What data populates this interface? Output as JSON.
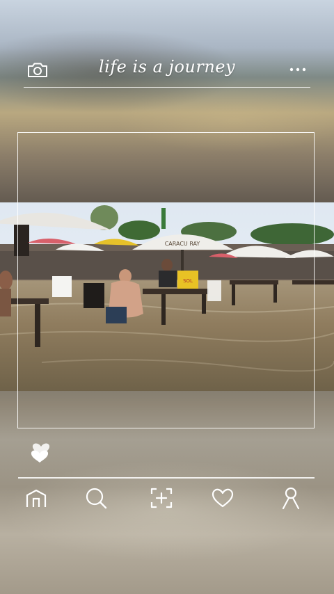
{
  "header": {
    "title": "life is a journey"
  },
  "icons": {
    "camera": "camera-icon",
    "more": "more-dots-icon",
    "like": "double-heart-icon",
    "home": "home-icon",
    "search": "search-icon",
    "scan": "scan-add-icon",
    "favorite": "heart-icon",
    "profile": "profile-icon"
  },
  "photo": {
    "umbrella_text": "CARACU RAY",
    "cooler_text": "SOL"
  },
  "colors": {
    "line": "#ffffff",
    "accent": "#ffffff"
  }
}
